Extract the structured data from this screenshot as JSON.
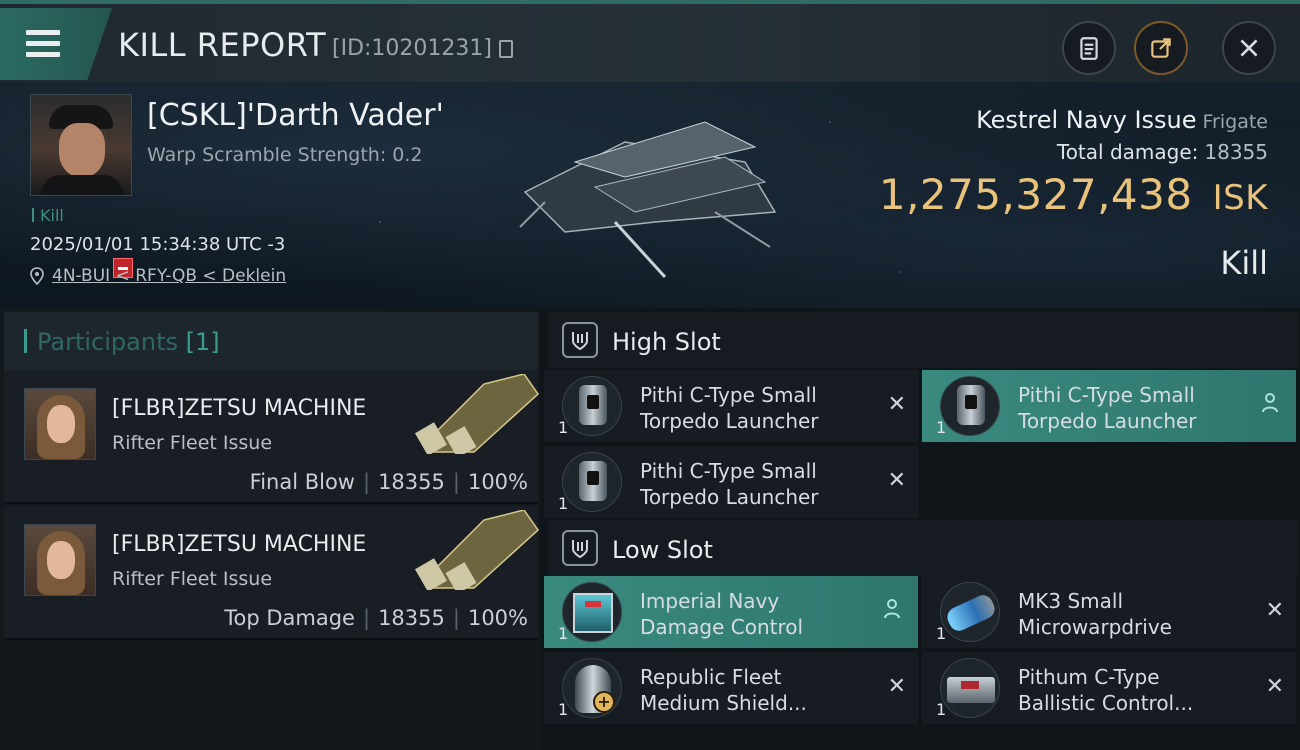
{
  "header": {
    "title": "KILL REPORT",
    "report_id": "[ID:10201231]"
  },
  "victim": {
    "name": "[CSKL]'Darth Vader'",
    "warp_scramble": "Warp Scramble Strength: 0.2",
    "tag": "Kill",
    "datetime": "2025/01/01 15:34:38 UTC -3",
    "location": "4N-BUI < RFY-QB < Deklein",
    "ship": "Kestrel Navy Issue",
    "ship_class": "Frigate",
    "total_damage_label": "Total damage:",
    "total_damage": "18355",
    "isk_value": "1,275,327,438",
    "isk_unit": "ISK",
    "result": "Kill"
  },
  "participants": {
    "label": "Participants",
    "count": "[1]",
    "rows": [
      {
        "name": "[FLBR]ZETSU MACHINE",
        "ship": "Rifter Fleet Issue",
        "role": "Final Blow",
        "damage": "18355",
        "percent": "100%"
      },
      {
        "name": "[FLBR]ZETSU MACHINE",
        "ship": "Rifter Fleet Issue",
        "role": "Top Damage",
        "damage": "18355",
        "percent": "100%"
      }
    ]
  },
  "fitting": {
    "high_slot_label": "High Slot",
    "low_slot_label": "Low Slot",
    "high": [
      {
        "name_line1": "Pithi C-Type Small",
        "name_line2": "Torpedo Launcher",
        "qty": "1",
        "status": "destroyed"
      },
      {
        "name_line1": "Pithi C-Type Small",
        "name_line2": "Torpedo Launcher",
        "qty": "1",
        "status": "dropped"
      },
      {
        "name_line1": "Pithi C-Type Small",
        "name_line2": "Torpedo Launcher",
        "qty": "1",
        "status": "destroyed"
      }
    ],
    "low": [
      {
        "name_line1": "Imperial Navy",
        "name_line2": "Damage Control",
        "qty": "1",
        "status": "dropped"
      },
      {
        "name_line1": "MK3 Small",
        "name_line2": "Microwarpdrive",
        "qty": "1",
        "status": "destroyed"
      },
      {
        "name_line1": "Republic Fleet",
        "name_line2": "Medium Shield...",
        "qty": "1",
        "status": "destroyed"
      },
      {
        "name_line1": "Pithum C-Type",
        "name_line2": "Ballistic Control...",
        "qty": "1",
        "status": "destroyed"
      }
    ],
    "destroyed_symbol": "✕"
  },
  "colors": {
    "accent_teal": "#3a8a7f",
    "isk_gold": "#e9c27b",
    "kill_badge": "#c0272d"
  },
  "icons": [
    "menu-icon",
    "clipboard-icon",
    "share-icon",
    "close-icon",
    "copy-icon",
    "location-pin-icon",
    "shield-slot-icon",
    "person-icon",
    "destroyed-x-icon"
  ]
}
